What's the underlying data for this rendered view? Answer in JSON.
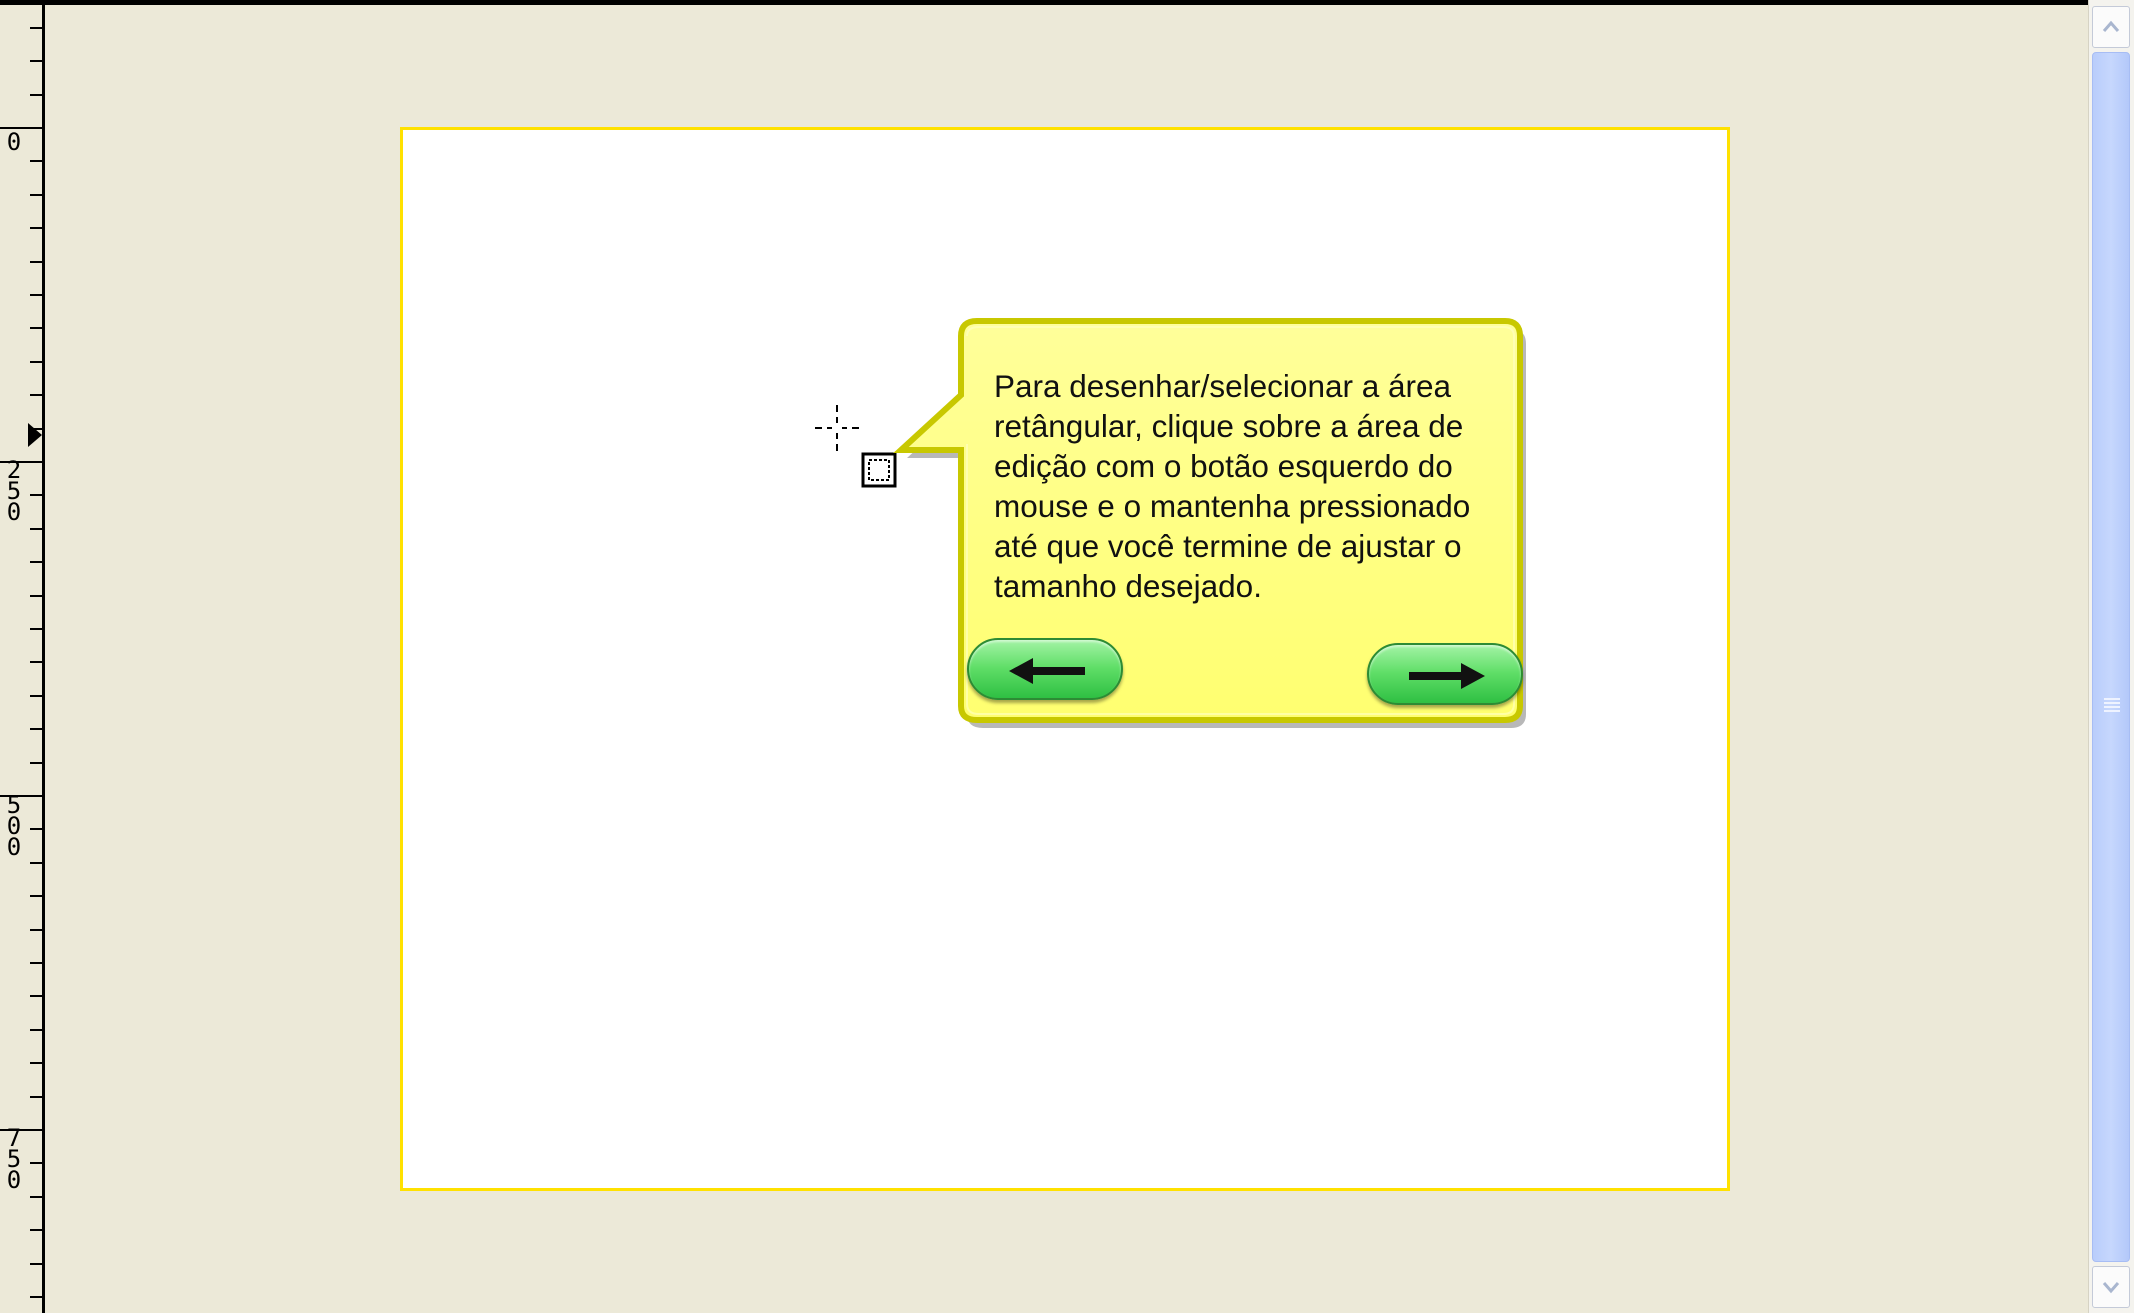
{
  "editor": {
    "ruler": {
      "labels": [
        "0",
        "2\n5\n0",
        "5\n0\n0",
        "7\n5\n0"
      ]
    },
    "tooltip": {
      "text": "Para desenhar/selecionar a área retângular, clique sobre a área de edição com o botão esquerdo do mouse e o mantenha pressionado até que você termine de ajustar o tamanho desejado.",
      "prev_icon": "arrow-left-icon",
      "next_icon": "arrow-right-icon"
    },
    "colors": {
      "workspace": "#ece9d8",
      "canvas": "#ffffff",
      "selection_border": "#ffe100",
      "balloon": "#ffff84",
      "nav_button": "#5fde67",
      "scrollbar_thumb": "#c1d3fb"
    }
  }
}
